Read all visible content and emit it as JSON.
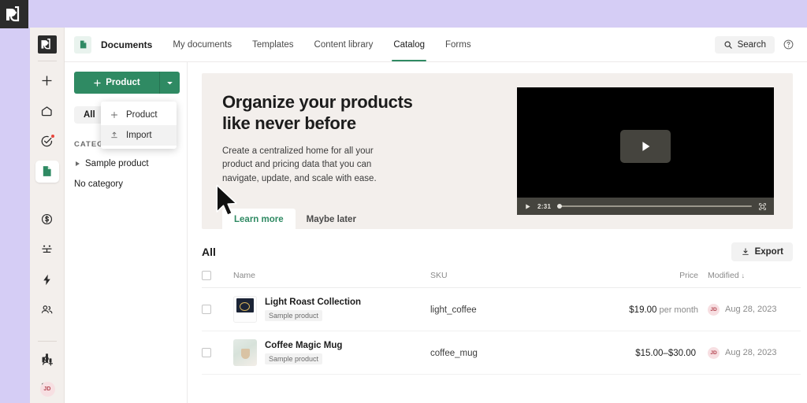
{
  "brand": {
    "logo_label": "pd",
    "accent": "#2f8a63",
    "bg": "#d5cdf5"
  },
  "rail": {
    "items": [
      {
        "name": "create-new",
        "icon": "plus-icon"
      },
      {
        "name": "home",
        "icon": "pentagon-home-icon"
      },
      {
        "name": "tasks",
        "icon": "check-circle-icon",
        "badge": true
      },
      {
        "name": "documents",
        "icon": "document-icon",
        "active": true
      },
      {
        "name": "quotes",
        "icon": "dollar-circle-icon"
      },
      {
        "name": "deals",
        "icon": "balance-icon"
      },
      {
        "name": "automations",
        "icon": "lightning-icon"
      },
      {
        "name": "contacts",
        "icon": "people-icon"
      },
      {
        "name": "reporting",
        "icon": "bar-chart-icon"
      },
      {
        "name": "forms",
        "icon": "form-card-icon"
      },
      {
        "name": "invite-user",
        "icon": "add-person-icon"
      }
    ],
    "avatar_initials": "JD"
  },
  "topnav": {
    "app_icon": "document-icon",
    "tabs": [
      {
        "label": "Documents",
        "state": "title"
      },
      {
        "label": "My documents",
        "state": "default"
      },
      {
        "label": "Templates",
        "state": "default"
      },
      {
        "label": "Content library",
        "state": "default"
      },
      {
        "label": "Catalog",
        "state": "selected"
      },
      {
        "label": "Forms",
        "state": "default"
      }
    ],
    "search_label": "Search",
    "help_icon": "question-circle-icon"
  },
  "sidebar": {
    "primary_button": "Product",
    "all_chip": "All",
    "categories_label": "CATEGORIES",
    "add_category_icon": "plus-icon",
    "category_items": [
      "Sample product"
    ],
    "no_category": "No category"
  },
  "dropdown": {
    "items": [
      {
        "label": "Product",
        "icon": "plus-icon",
        "hover": false
      },
      {
        "label": "Import",
        "icon": "upload-icon",
        "hover": true
      }
    ]
  },
  "promo": {
    "title_line1": "Organize your products",
    "title_line2": "like never before",
    "description": "Create a centralized home for all your product and pricing data that you can navigate, update, and scale with ease.",
    "primary_cta": "Learn more",
    "secondary_cta": "Maybe later",
    "video": {
      "time": "2:31",
      "play_icon": "play-icon",
      "fullscreen_icon": "fullscreen-icon"
    }
  },
  "table": {
    "title": "All",
    "export_label": "Export",
    "columns": [
      "",
      "Name",
      "SKU",
      "Price",
      "Modified"
    ],
    "sort_column": "Modified",
    "sort_arrow": "↓",
    "rows": [
      {
        "name": "Light Roast Collection",
        "badge": "Sample product",
        "sku": "light_coffee",
        "price": "$19.00",
        "price_unit": "per month",
        "modified_by": "JD",
        "modified": "Aug 28, 2023",
        "thumb": "t1"
      },
      {
        "name": "Coffee Magic Mug",
        "badge": "Sample product",
        "sku": "coffee_mug",
        "price": "$15.00–$30.00",
        "price_unit": "",
        "modified_by": "JD",
        "modified": "Aug 28, 2023",
        "thumb": "t2"
      }
    ]
  }
}
